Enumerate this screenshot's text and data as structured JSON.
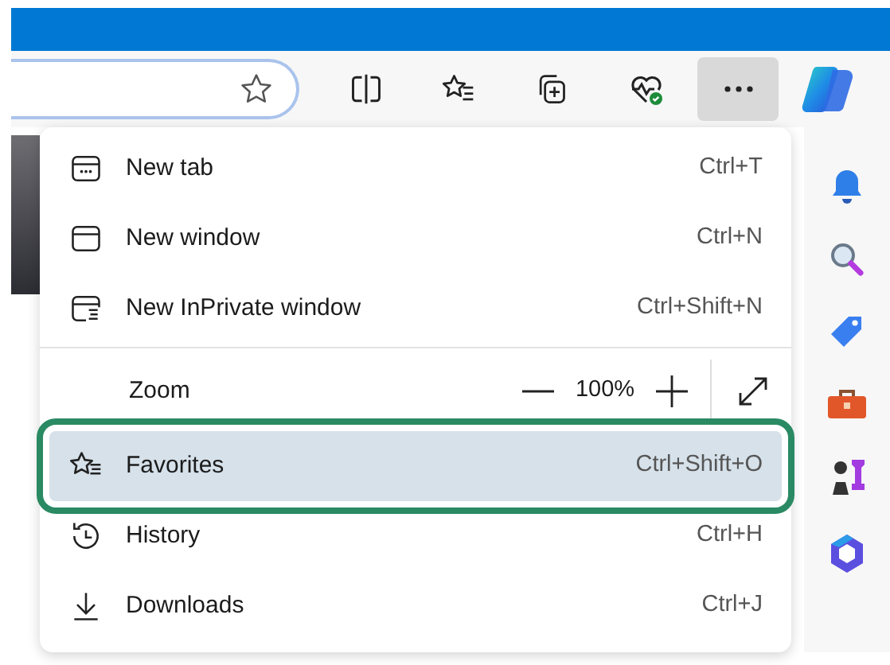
{
  "menu": {
    "items": [
      {
        "kind": "item",
        "label": "New tab",
        "shortcut": "Ctrl+T",
        "selected": false
      },
      {
        "kind": "item",
        "label": "New window",
        "shortcut": "Ctrl+N",
        "selected": false
      },
      {
        "kind": "item",
        "label": "New InPrivate window",
        "shortcut": "Ctrl+Shift+N",
        "selected": false
      },
      {
        "kind": "divider"
      },
      {
        "kind": "zoom",
        "label": "Zoom",
        "value": "100%"
      },
      {
        "kind": "item",
        "label": "Favorites",
        "shortcut": "Ctrl+Shift+O",
        "selected": true
      },
      {
        "kind": "item",
        "label": "History",
        "shortcut": "Ctrl+H",
        "selected": false
      },
      {
        "kind": "item",
        "label": "Downloads",
        "shortcut": "Ctrl+J",
        "selected": false
      }
    ]
  }
}
